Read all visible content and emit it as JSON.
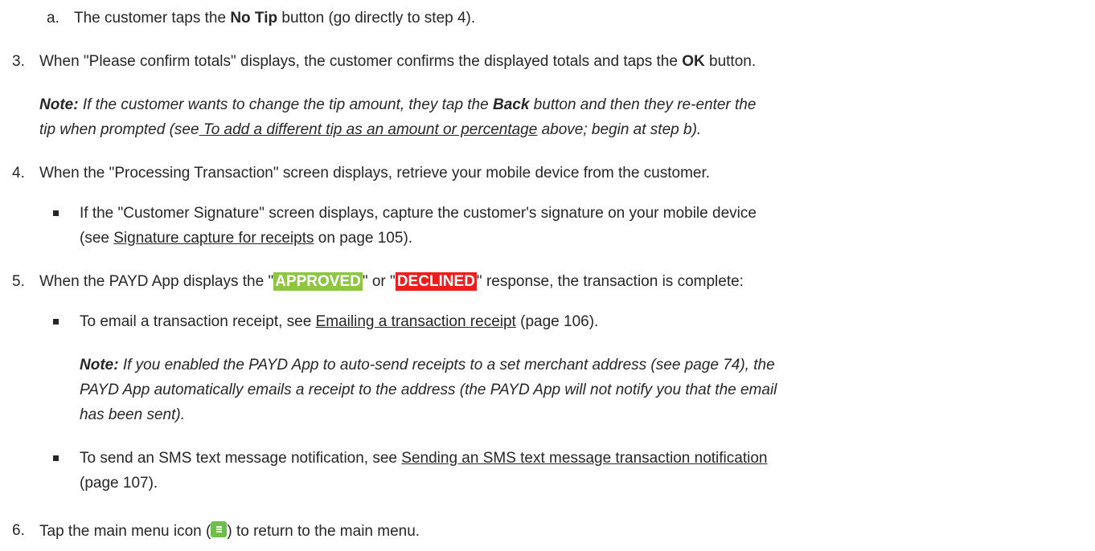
{
  "step_2a": {
    "marker": "a.",
    "t1": "The customer taps the ",
    "bold": "No Tip",
    "t2": " button (go directly to step 4)."
  },
  "step_3": {
    "marker": "3.",
    "t1": "When \"Please confirm totals\" displays, the customer confirms the displayed totals and taps the ",
    "bold": "OK",
    "t2": " button."
  },
  "note_1": {
    "label": "Note:",
    "t1": "   If the customer wants to change the tip amount, they tap the ",
    "bold": "Back",
    "t2": " button and then they re-enter the",
    "t3": "tip when prompted (see",
    "link": " To add a different tip as an amount or percentage",
    "t4": " above; begin at step b)."
  },
  "step_4": {
    "marker": "4.",
    "text": "When the \"Processing Transaction\" screen displays, retrieve your mobile device from the customer."
  },
  "bullet_signature": {
    "t1": "If the \"Customer Signature\" screen displays, capture the customer's signature on your mobile device",
    "t2": "(see ",
    "link": "Signature capture for receipts",
    "t3": " on page 105)."
  },
  "step_5": {
    "marker": "5.",
    "t1": "When the PAYD App displays the \"",
    "approved": "APPROVED",
    "t2": "\" or \"",
    "declined": "DECLINED",
    "t3": "\" response, the transaction is complete:"
  },
  "bullet_email": {
    "t1": "To email a transaction receipt, see ",
    "link": "Emailing a transaction receipt",
    "t2": " (page 106)."
  },
  "note_2": {
    "label": "Note:",
    "l1": "   If you enabled the PAYD App to auto-send receipts to a set merchant address (see page 74), the",
    "l2": "PAYD App automatically emails a receipt to the address (the PAYD App will not notify you that the email",
    "l3": "has been sent)."
  },
  "bullet_sms": {
    "t1": "To send an SMS text message notification, see ",
    "link": "Sending an SMS text message transaction notification",
    "t2": "(page 107)."
  },
  "step_6": {
    "marker": "6.",
    "t1": "Tap the main menu icon (",
    "icon": "main-menu-icon",
    "t2": ") to return to the main menu."
  },
  "colors": {
    "text": "#262626",
    "approved_bg": "#8fc641",
    "declined_bg": "#ee1c1c",
    "menu_icon_bg": "#6cc04a"
  }
}
